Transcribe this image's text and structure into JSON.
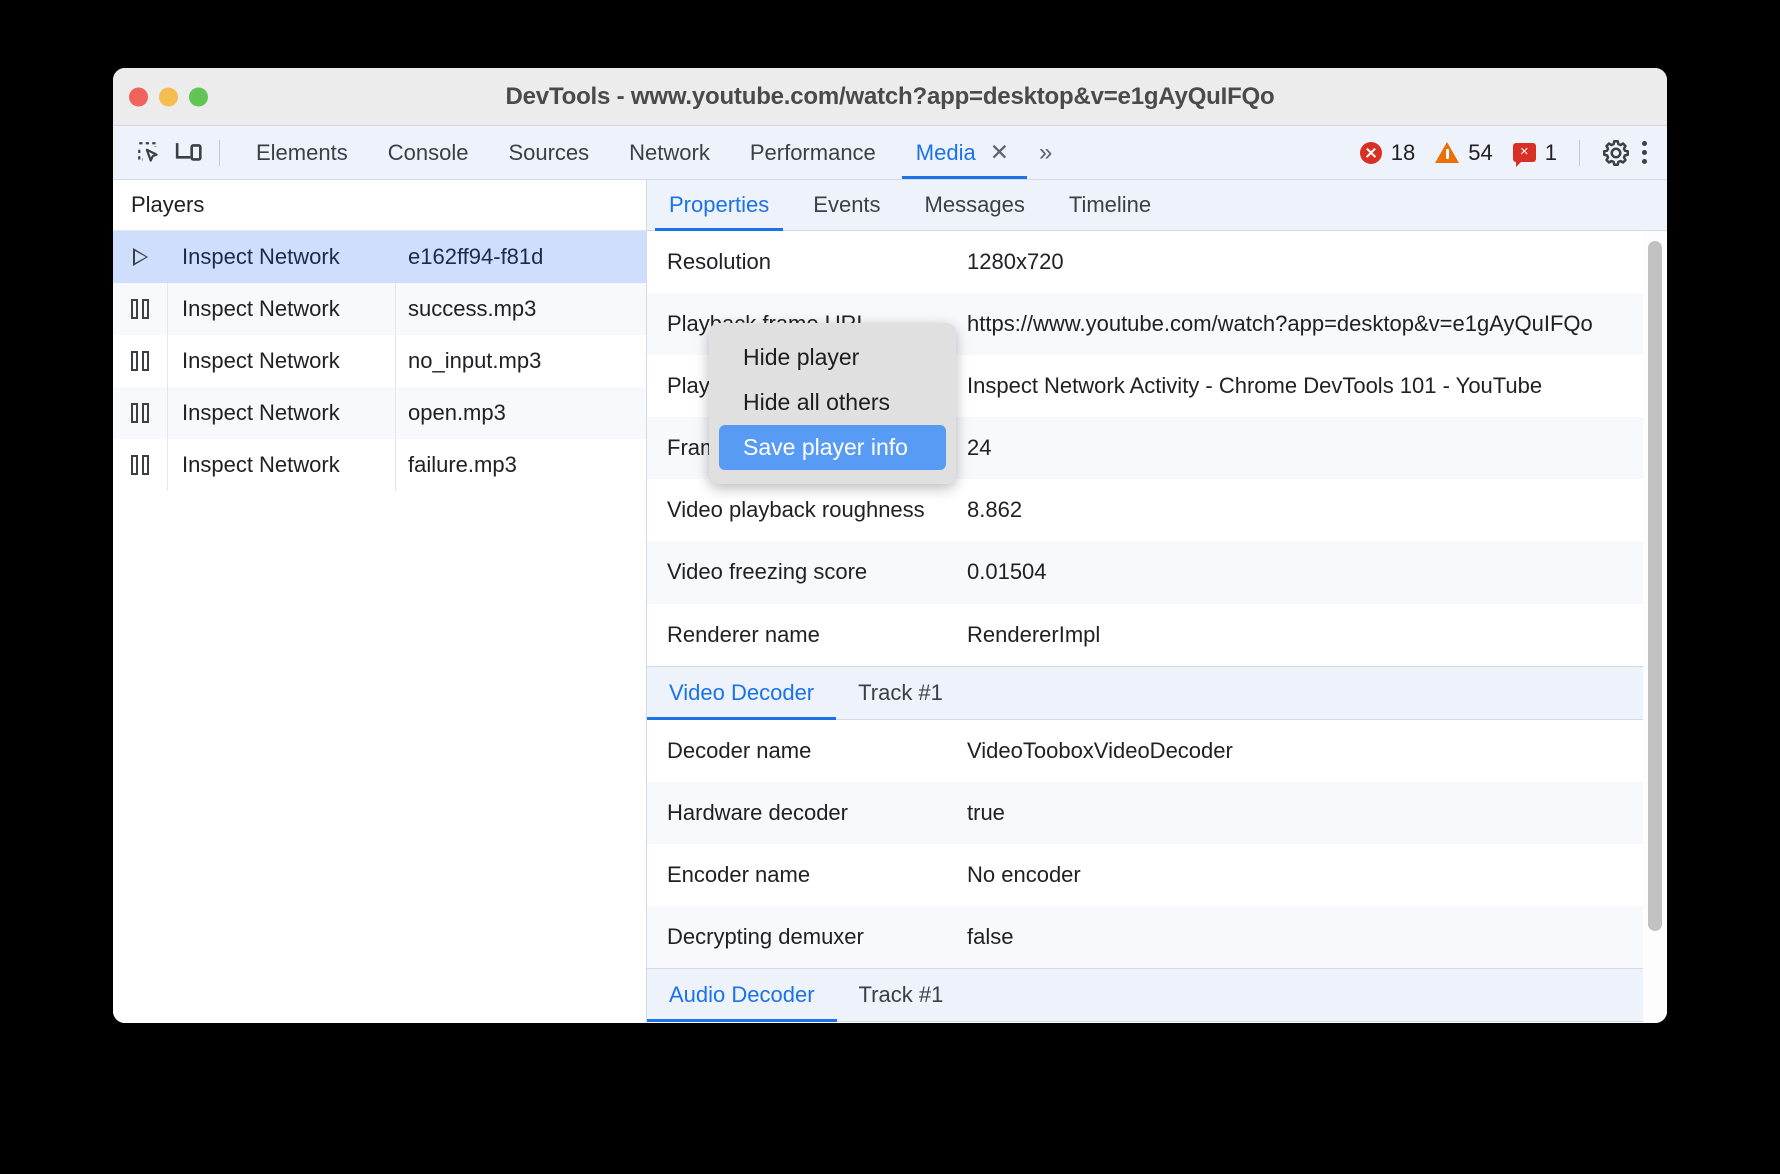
{
  "window": {
    "title": "DevTools - www.youtube.com/watch?app=desktop&v=e1gAyQuIFQo"
  },
  "toolbar": {
    "inspect_icon": "inspect-element-icon",
    "device_icon": "device-toolbar-icon",
    "tabs": [
      {
        "label": "Elements",
        "active": false
      },
      {
        "label": "Console",
        "active": false
      },
      {
        "label": "Sources",
        "active": false
      },
      {
        "label": "Network",
        "active": false
      },
      {
        "label": "Performance",
        "active": false
      },
      {
        "label": "Media",
        "active": true
      }
    ],
    "close_tab_glyph": "✕",
    "more_tabs_glyph": "»",
    "errors_count": "18",
    "warnings_count": "54",
    "issues_count": "1",
    "settings_icon": "gear-icon",
    "more_options_icon": "kebab-menu-icon"
  },
  "players_pane": {
    "header": "Players",
    "rows": [
      {
        "state_icon": "play-icon",
        "name": "Inspect Network",
        "id": "e162ff94-f81d",
        "selected": true
      },
      {
        "state_icon": "pause-icon",
        "name": "Inspect Network",
        "id": "success.mp3",
        "selected": false
      },
      {
        "state_icon": "pause-icon",
        "name": "Inspect Network",
        "id": "no_input.mp3",
        "selected": false
      },
      {
        "state_icon": "pause-icon",
        "name": "Inspect Network",
        "id": "open.mp3",
        "selected": false
      },
      {
        "state_icon": "pause-icon",
        "name": "Inspect Network",
        "id": "failure.mp3",
        "selected": false
      }
    ]
  },
  "details_pane": {
    "tabs": [
      {
        "label": "Properties",
        "active": true
      },
      {
        "label": "Events",
        "active": false
      },
      {
        "label": "Messages",
        "active": false
      },
      {
        "label": "Timeline",
        "active": false
      }
    ],
    "properties": [
      {
        "key": "Resolution",
        "value": "1280x720"
      },
      {
        "key": "Playback frame URL",
        "value": "https://www.youtube.com/watch?app=desktop&v=e1gAyQuIFQo"
      },
      {
        "key": "Playback frame title",
        "value": "Inspect Network Activity - Chrome DevTools 101 - YouTube"
      },
      {
        "key": "Frame rate",
        "value": "24"
      },
      {
        "key": "Video playback roughness",
        "value": "8.862"
      },
      {
        "key": "Video freezing score",
        "value": "0.01504"
      },
      {
        "key": "Renderer name",
        "value": "RendererImpl"
      }
    ],
    "video_decoder_section": {
      "tab_label": "Video Decoder",
      "track_label": "Track #1",
      "rows": [
        {
          "key": "Decoder name",
          "value": "VideoTooboxVideoDecoder"
        },
        {
          "key": "Hardware decoder",
          "value": "true"
        },
        {
          "key": "Encoder name",
          "value": "No encoder"
        },
        {
          "key": "Decrypting demuxer",
          "value": "false"
        }
      ]
    },
    "audio_decoder_section": {
      "tab_label": "Audio Decoder",
      "track_label": "Track #1"
    }
  },
  "context_menu": {
    "items": [
      {
        "label": "Hide player",
        "highlighted": false
      },
      {
        "label": "Hide all others",
        "highlighted": false
      },
      {
        "label": "Save player info",
        "highlighted": true
      }
    ]
  },
  "colors": {
    "accent": "#1a73e8",
    "selection": "#cfdefc",
    "menu_highlight": "#589bf5",
    "error": "#d93025",
    "warning": "#e8710a"
  }
}
